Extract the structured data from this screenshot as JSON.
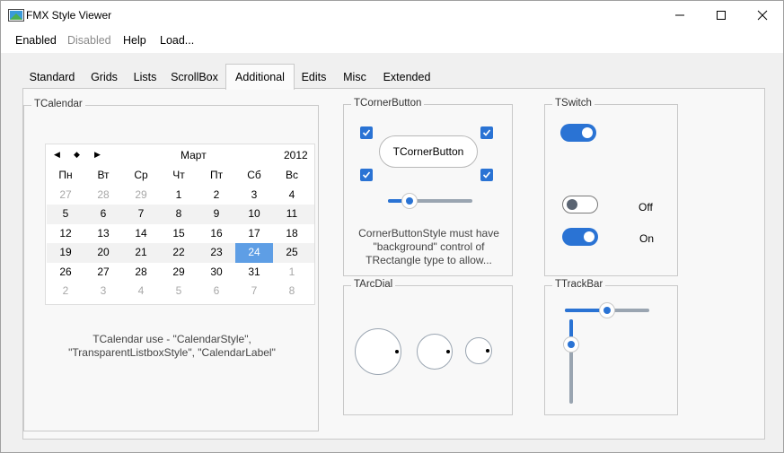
{
  "window": {
    "title": "FMX Style Viewer"
  },
  "menu": {
    "items": [
      {
        "label": "Enabled",
        "enabled": true
      },
      {
        "label": "Disabled",
        "enabled": false
      },
      {
        "label": "Help",
        "enabled": true
      },
      {
        "label": "Load...",
        "enabled": true
      }
    ]
  },
  "tabs": {
    "items": [
      "Standard",
      "Grids",
      "Lists",
      "ScrollBox",
      "Additional",
      "Edits",
      "Misc",
      "Extended"
    ],
    "active": "Additional"
  },
  "calendar_group": {
    "title": "TCalendar",
    "month": "Март",
    "year": "2012",
    "weekdays": [
      "Пн",
      "Вт",
      "Ср",
      "Чт",
      "Пт",
      "Сб",
      "Вс"
    ],
    "weeks": [
      [
        "27",
        "28",
        "29",
        "1",
        "2",
        "3",
        "4"
      ],
      [
        "5",
        "6",
        "7",
        "8",
        "9",
        "10",
        "11"
      ],
      [
        "12",
        "13",
        "14",
        "15",
        "16",
        "17",
        "18"
      ],
      [
        "19",
        "20",
        "21",
        "22",
        "23",
        "24",
        "25"
      ],
      [
        "26",
        "27",
        "28",
        "29",
        "30",
        "31",
        "1"
      ],
      [
        "2",
        "3",
        "4",
        "5",
        "6",
        "7",
        "8"
      ]
    ],
    "selected_day": "24",
    "caption_line1": "TCalendar use - \"CalendarStyle\",",
    "caption_line2": "\"TransparentListboxStyle\", \"CalendarLabel\""
  },
  "corner_group": {
    "title": "TCornerButton",
    "button_label": "TCornerButton",
    "slider_value_percent": 25,
    "caption_line1": "CornerButtonStyle must have",
    "caption_line2": "\"background\" control of",
    "caption_line3": "TRectangle type to allow..."
  },
  "switch_group": {
    "title": "TSwitch",
    "off_label": "Off",
    "on_label": "On",
    "switches": [
      true,
      false,
      true
    ]
  },
  "arcdial_group": {
    "title": "TArcDial"
  },
  "trackbar_group": {
    "title": "TTrackBar",
    "horizontal_value_percent": 50,
    "vertical_value_percent": 30
  },
  "colors": {
    "accent": "#2a73d4",
    "selected_day": "#5e9ee5",
    "track": "#9aa5b1"
  }
}
